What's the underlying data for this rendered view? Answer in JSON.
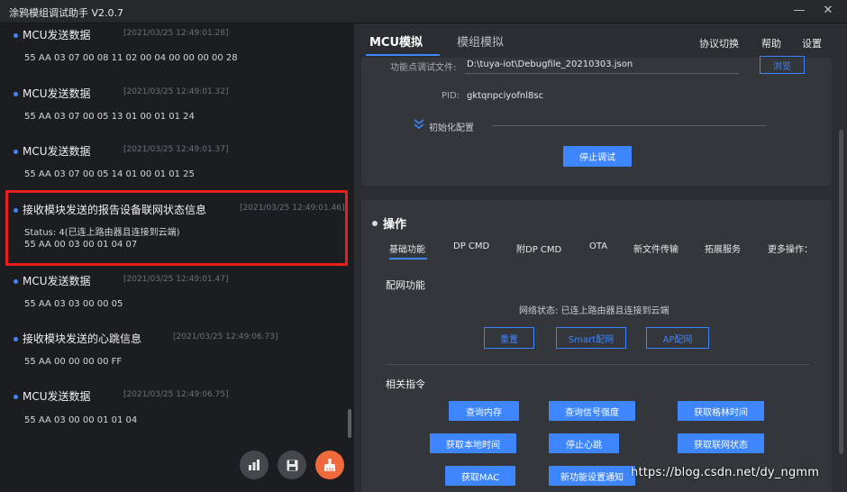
{
  "window": {
    "title": "涂鸦模组调试助手 V2.0.7",
    "minimize": "—",
    "close": "✕"
  },
  "log": [
    {
      "title": "MCU发送数据",
      "time": "[2021/03/25 12:49:01.28]",
      "lines": [
        "55 AA 03 07 00 08 11 02 00 04 00 00 00 00 28"
      ]
    },
    {
      "title": "MCU发送数据",
      "time": "[2021/03/25 12:49:01.32]",
      "lines": [
        "55 AA 03 07 00 05 13 01 00 01 01 24"
      ]
    },
    {
      "title": "MCU发送数据",
      "time": "[2021/03/25 12:49:01.37]",
      "lines": [
        "55 AA 03 07 00 05 14 01 00 01 01 25"
      ]
    },
    {
      "title": "接收模块发送的报告设备联网状态信息",
      "time": "[2021/03/25 12:49:01.46]",
      "lines": [
        "Status: 4(已连上路由器且连接到云端)",
        "55 AA 00 03 00 01 04 07"
      ]
    },
    {
      "title": "MCU发送数据",
      "time": "[2021/03/25 12:49:01.47]",
      "lines": [
        "55 AA 03 03 00 00 05"
      ]
    },
    {
      "title": "接收模块发送的心跳信息",
      "time": "[2021/03/25 12:49:06.73]",
      "lines": [
        "55 AA 00 00 00 00 FF"
      ]
    },
    {
      "title": "MCU发送数据",
      "time": "[2021/03/25 12:49:06.75]",
      "lines": [
        "55 AA 03 00 00 01 01 04"
      ]
    }
  ],
  "tabs": {
    "mcu": "MCU模拟",
    "module": "模组模拟"
  },
  "toplinks": {
    "protocol": "协议切换",
    "help": "帮助",
    "settings": "设置"
  },
  "config": {
    "file_label": "功能点调试文件:",
    "file_value": "D:\\tuya-iot\\Debugfile_20210303.json",
    "browse": "浏览",
    "pid_label": "PID:",
    "pid_value": "gktqnpciyofnl8sc",
    "init": "初始化配置",
    "stop_debug": "停止调试"
  },
  "ops": {
    "title": "操作",
    "subtabs": [
      "基础功能",
      "DP CMD",
      "附DP CMD",
      "OTA",
      "新文件传输",
      "拓展服务",
      "更多操作："
    ],
    "network": {
      "title": "配网功能",
      "status": "网络状态: 已连上路由器且连接到云端",
      "reset": "重置",
      "smart": "Smart配网",
      "ap": "AP配网"
    },
    "commands": {
      "title": "相关指令",
      "items": [
        "查询内存",
        "查询信号强度",
        "获取格林时间",
        "获取本地时间",
        "停止心跳",
        "获取联网状态",
        "获取MAC",
        "新功能设置通知"
      ]
    }
  },
  "watermark": "https://blog.csdn.net/dy_ngmm",
  "colors": {
    "accent": "#3d86ff",
    "highlight": "#e81f1f",
    "fab_orange": "#f06a3d"
  }
}
